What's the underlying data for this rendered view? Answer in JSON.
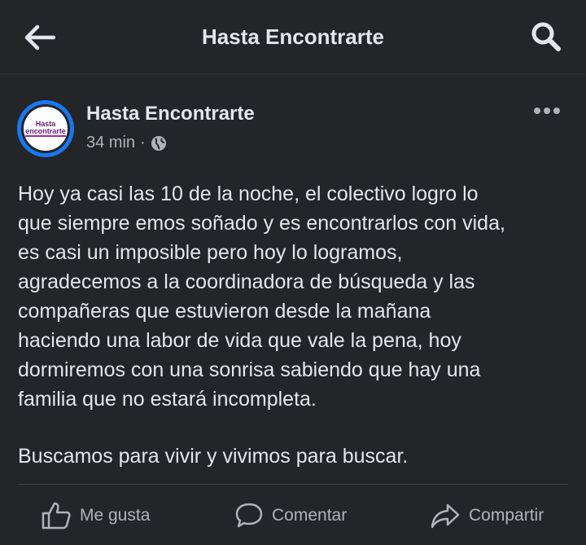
{
  "header": {
    "title": "Hasta Encontrarte",
    "back_icon": "arrow-left-icon",
    "search_icon": "search-icon"
  },
  "post": {
    "author": "Hasta Encontrarte",
    "avatar": {
      "line1": "Hasta",
      "line2": "encontrarte"
    },
    "time": "34 min",
    "separator": "·",
    "privacy_icon": "globe-icon",
    "more_icon": "more-horizontal-icon",
    "body": "Hoy ya casi las 10 de la noche, el colectivo logro lo\nque siempre emos soñado y es encontrarlos con vida,\nes casi un imposible pero hoy lo logramos,\nagradecemos a la coordinadora de búsqueda y las\ncompañeras que estuvieron desde la mañana\nhaciendo una labor de vida que vale la pena, hoy\ndormiremos con una sonrisa sabiendo que hay una\nfamilia que no estará incompleta.",
    "tagline": "Buscamos para vivir y vivimos para buscar."
  },
  "actions": {
    "like": "Me gusta",
    "comment": "Comentar",
    "share": "Compartir"
  },
  "colors": {
    "background": "#18191a",
    "surface": "#242526",
    "text_primary": "#e4e6eb",
    "text_secondary": "#b0b3b8",
    "avatar_ring": "#1877f2"
  }
}
